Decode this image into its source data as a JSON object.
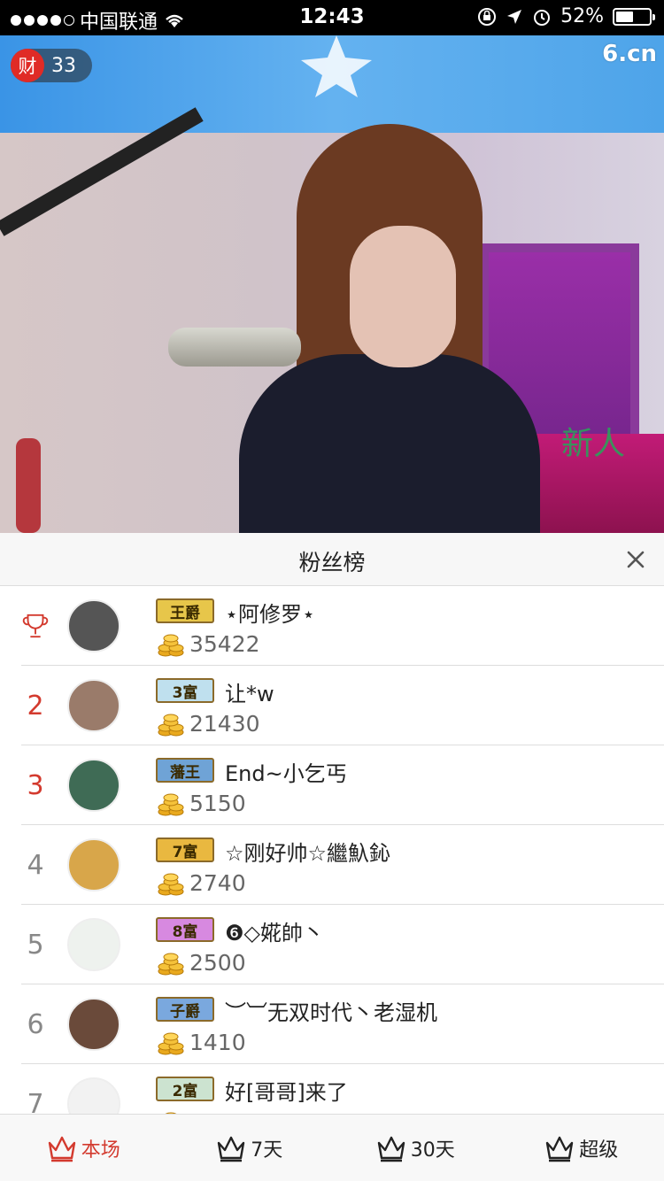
{
  "status_bar": {
    "carrier": "中国联通",
    "time": "12:43",
    "battery": "52%",
    "battery_level": 0.52
  },
  "video": {
    "site_logo": "6.cn",
    "watermark": "新人",
    "rich_badge": {
      "icon": "财",
      "count": "33"
    }
  },
  "panel": {
    "title": "粉丝榜",
    "close_icon": "close-icon"
  },
  "fans": [
    {
      "rank": "",
      "rank_icon": "trophy-icon",
      "badge": "王爵",
      "badge_color": "#e7c64a",
      "name": "⋆阿修罗⋆",
      "score": "35422"
    },
    {
      "rank": "2",
      "badge": "3富",
      "badge_color": "#bfe0ee",
      "name": "让*w",
      "score": "21430"
    },
    {
      "rank": "3",
      "badge": "藩王",
      "badge_color": "#6fa3d6",
      "name": "End~小乞丐",
      "score": "5150"
    },
    {
      "rank": "4",
      "badge": "7富",
      "badge_color": "#e9b840",
      "name": "☆刚好帅☆繼魞鈊",
      "score": "2740"
    },
    {
      "rank": "5",
      "badge": "8富",
      "badge_color": "#d789e0",
      "name": "❻◇婲帥丶",
      "score": "2500"
    },
    {
      "rank": "6",
      "badge": "子爵",
      "badge_color": "#7aa8de",
      "name": "︶︺无双时代丶老湿机",
      "score": "1410"
    },
    {
      "rank": "7",
      "badge": "2富",
      "badge_color": "#cce3d0",
      "name": "好[哥哥]来了",
      "score": ""
    }
  ],
  "tabs": [
    {
      "label": "本场",
      "icon": "crown-icon",
      "active": true
    },
    {
      "label": "7天",
      "icon": "crown-icon",
      "active": false
    },
    {
      "label": "30天",
      "icon": "crown-icon",
      "active": false
    },
    {
      "label": "超级",
      "icon": "crown-icon",
      "active": false
    }
  ],
  "colors": {
    "accent": "#d33a2e",
    "gold": "#e9b840"
  }
}
